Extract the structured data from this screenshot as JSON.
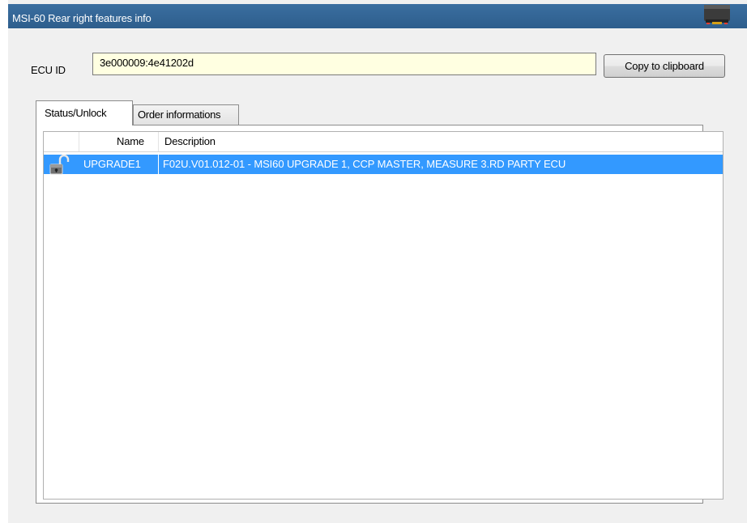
{
  "window": {
    "title": "MSI-60 Rear right features info",
    "app_icon": "truck-icon"
  },
  "ecu": {
    "label": "ECU ID",
    "value": "3e000009:4e41202d",
    "copy_button": "Copy to clipboard"
  },
  "tabs": [
    {
      "label": "Status/Unlock",
      "selected": true
    },
    {
      "label": "Order informations",
      "selected": false
    }
  ],
  "list": {
    "columns": [
      "",
      "Name",
      "Description"
    ],
    "rows": [
      {
        "status_icon": "unlocked-padlock-icon",
        "name": "UPGRADE1",
        "description": "F02U.V01.012-01 - MSI60 UPGRADE 1, CCP MASTER, MEASURE 3.RD PARTY ECU",
        "selected": true
      }
    ]
  },
  "colors": {
    "titlebar": "#2e5e8c",
    "selection": "#3399ff",
    "input_background": "#ffffe1",
    "window_background": "#f0f0f0"
  }
}
